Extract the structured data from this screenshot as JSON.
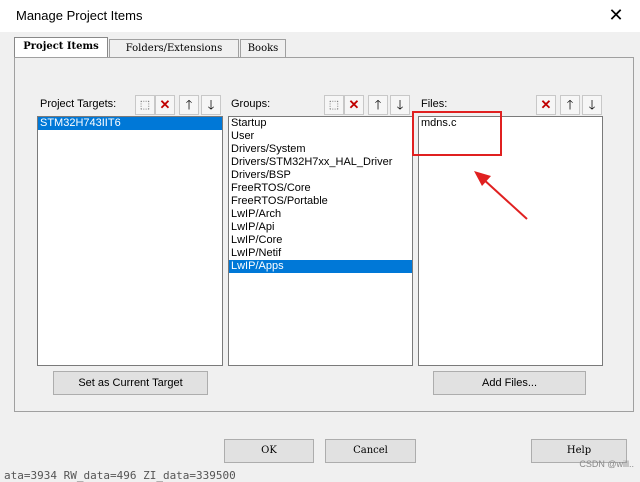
{
  "window": {
    "title": "Manage Project Items",
    "close_glyph": "✕"
  },
  "tabs": [
    {
      "label": "Project Items",
      "active": true
    },
    {
      "label": "Folders/Extensions",
      "active": false
    },
    {
      "label": "Books",
      "active": false
    }
  ],
  "targets": {
    "label": "Project Targets:",
    "items": [
      "STM32H743IIT6"
    ],
    "selected": "STM32H743IIT6",
    "button": "Set as Current Target"
  },
  "groups": {
    "label": "Groups:",
    "items": [
      "Startup",
      "User",
      "Drivers/System",
      "Drivers/STM32H7xx_HAL_Driver",
      "Drivers/BSP",
      "FreeRTOS/Core",
      "FreeRTOS/Portable",
      "LwIP/Arch",
      "LwIP/Api",
      "LwIP/Core",
      "LwIP/Netif",
      "LwIP/Apps"
    ],
    "selected": "LwIP/Apps"
  },
  "files": {
    "label": "Files:",
    "items": [
      "mdns.c"
    ],
    "button": "Add Files..."
  },
  "toolbar_icons": {
    "new": "new-item-icon",
    "delete": "delete-icon",
    "up": "move-up-icon",
    "down": "move-down-icon",
    "delete_color": "#c00000"
  },
  "footer": {
    "ok": "OK",
    "cancel": "Cancel",
    "help": "Help"
  },
  "background_text": "ata=3934 RW_data=496 ZI_data=339500",
  "watermark": "CSDN @will..",
  "annotation_color": "#e02020"
}
